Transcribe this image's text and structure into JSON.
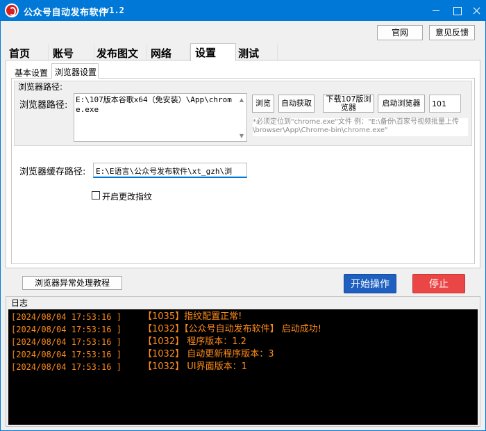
{
  "window": {
    "title": "公众号自动发布软件",
    "version": "v1.2"
  },
  "header": {
    "official_label": "官网",
    "feedback_label": "意见反馈"
  },
  "main_tabs": [
    {
      "label": "首页"
    },
    {
      "label": "账号"
    },
    {
      "label": "发布图文"
    },
    {
      "label": "网络"
    },
    {
      "label": "设置"
    },
    {
      "label": "测试"
    }
  ],
  "sub_tabs": [
    {
      "label": "基本设置"
    },
    {
      "label": "浏览器设置"
    }
  ],
  "browser": {
    "group_title": "浏览器路径:",
    "path_label": "浏览器路径:",
    "path_value": "E:\\107版本谷歌x64（免安装）\\App\\chrome.exe",
    "browse_label": "浏览",
    "autoget_label": "自动获取",
    "download_label": "下载107版浏览器",
    "launch_label": "启动浏览器",
    "port_value": "101",
    "hint_text": "*必须定位到\"chrome.exe\"文件        例：\"E:\\备份\\百家号视频批量上传\\browser\\App\\Chrome-bin\\chrome.exe\"",
    "cache_label": "浏览器缓存路径:",
    "cache_value": "E:\\E语言\\公众号发布软件\\xt_gzh\\浏",
    "fingerprint_label": "开启更改指纹",
    "fingerprint_checked": false
  },
  "toolbar": {
    "tutorial_label": "浏览器异常处理教程",
    "start_label": "开始操作",
    "stop_label": "停止"
  },
  "log": {
    "title": "日志",
    "lines": [
      {
        "time": "[2024/08/04 17:53:16 ]",
        "msg": "【1035】指纹配置正常!"
      },
      {
        "time": "[2024/08/04 17:53:16 ]",
        "msg": "【1032】【公众号自动发布软件】 启动成功!"
      },
      {
        "time": "[2024/08/04 17:53:16 ]",
        "msg": "【1032】 程序版本：1.2"
      },
      {
        "time": "[2024/08/04 17:53:16 ]",
        "msg": "【1032】 自动更新程序版本：3"
      },
      {
        "time": "[2024/08/04 17:53:16 ]",
        "msg": "【1032】 UI界面版本：1"
      }
    ]
  },
  "colors": {
    "titlebar": "#0078d7",
    "start_button": "#1e5fbf",
    "stop_button": "#ea4646",
    "log_text": "#ff8c1a",
    "log_bg": "#000000"
  }
}
